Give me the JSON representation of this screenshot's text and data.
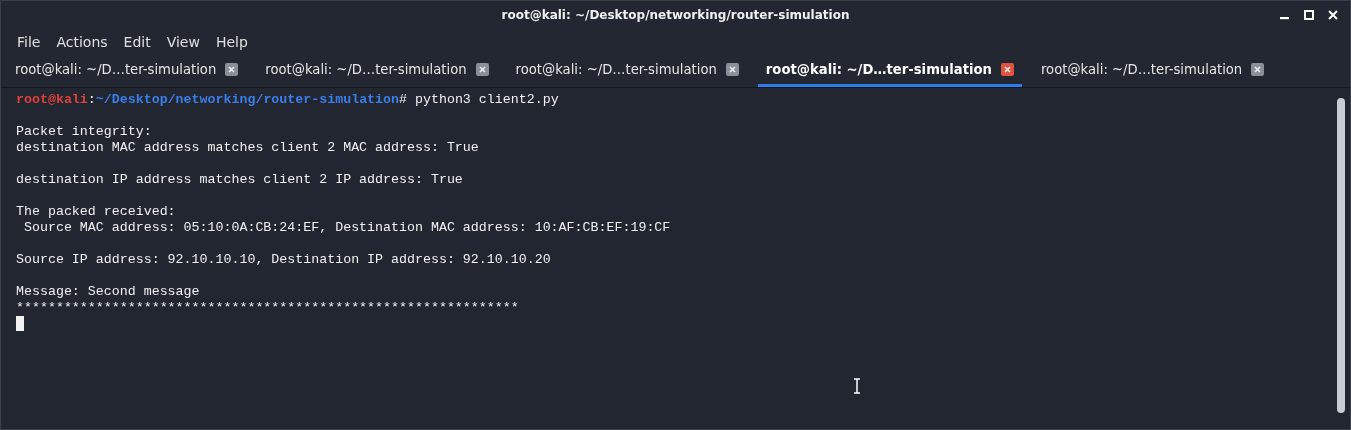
{
  "window": {
    "title": "root@kali: ~/Desktop/networking/router-simulation"
  },
  "menu": [
    "File",
    "Actions",
    "Edit",
    "View",
    "Help"
  ],
  "tabs": [
    {
      "label": "root@kali: ~/D…ter-simulation",
      "selected": false
    },
    {
      "label": "root@kali: ~/D…ter-simulation",
      "selected": false
    },
    {
      "label": "root@kali: ~/D…ter-simulation",
      "selected": false
    },
    {
      "label": "root@kali: ~/D…ter-simulation",
      "selected": true
    },
    {
      "label": "root@kali: ~/D…ter-simulation",
      "selected": false
    }
  ],
  "terminal": {
    "prompt": {
      "user": "root@kali",
      "separator": ":",
      "path": "~/Desktop/networking/router-simulation",
      "command": "# python3 client2.py"
    },
    "lines": [
      {
        "kind": "blank"
      },
      {
        "kind": "text",
        "text": "Packet integrity:"
      },
      {
        "kind": "text",
        "text": "destination MAC address matches client 2 MAC address: True"
      },
      {
        "kind": "blank"
      },
      {
        "kind": "text",
        "text": "destination IP address matches client 2 IP address: True"
      },
      {
        "kind": "blank"
      },
      {
        "kind": "text",
        "text": "The packed received:"
      },
      {
        "kind": "text",
        "text": " Source MAC address: 05:10:0A:CB:24:EF, Destination MAC address: 10:AF:CB:EF:19:CF"
      },
      {
        "kind": "blank"
      },
      {
        "kind": "text",
        "text": "Source IP address: 92.10.10.10, Destination IP address: 92.10.10.20"
      },
      {
        "kind": "blank"
      },
      {
        "kind": "text",
        "text": "Message: Second message"
      },
      {
        "kind": "text",
        "text": "***************************************************************"
      }
    ]
  }
}
